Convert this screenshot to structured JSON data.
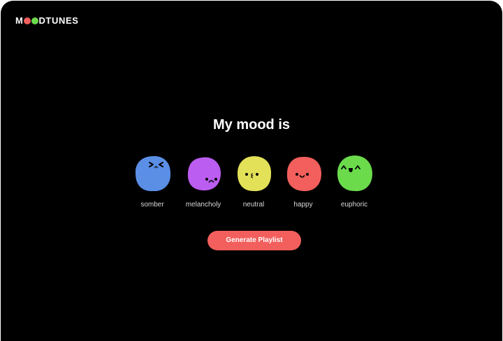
{
  "brand": {
    "prefix": "M",
    "suffix": "DTUNES",
    "dot_colors": [
      "#f25f5c",
      "#6bdb4c"
    ]
  },
  "headline": "My mood is",
  "moods": [
    {
      "label": "somber",
      "color": "#5b8fe6",
      "face": "tearful"
    },
    {
      "label": "melancholy",
      "color": "#bb5df0",
      "face": "sad"
    },
    {
      "label": "neutral",
      "color": "#e3e158",
      "face": "neutral"
    },
    {
      "label": "happy",
      "color": "#f25f5c",
      "face": "smile"
    },
    {
      "label": "euphoric",
      "color": "#6bdb4c",
      "face": "joyful"
    }
  ],
  "generate_button": {
    "label": "Generate Playlist",
    "color": "#f25f5c"
  }
}
